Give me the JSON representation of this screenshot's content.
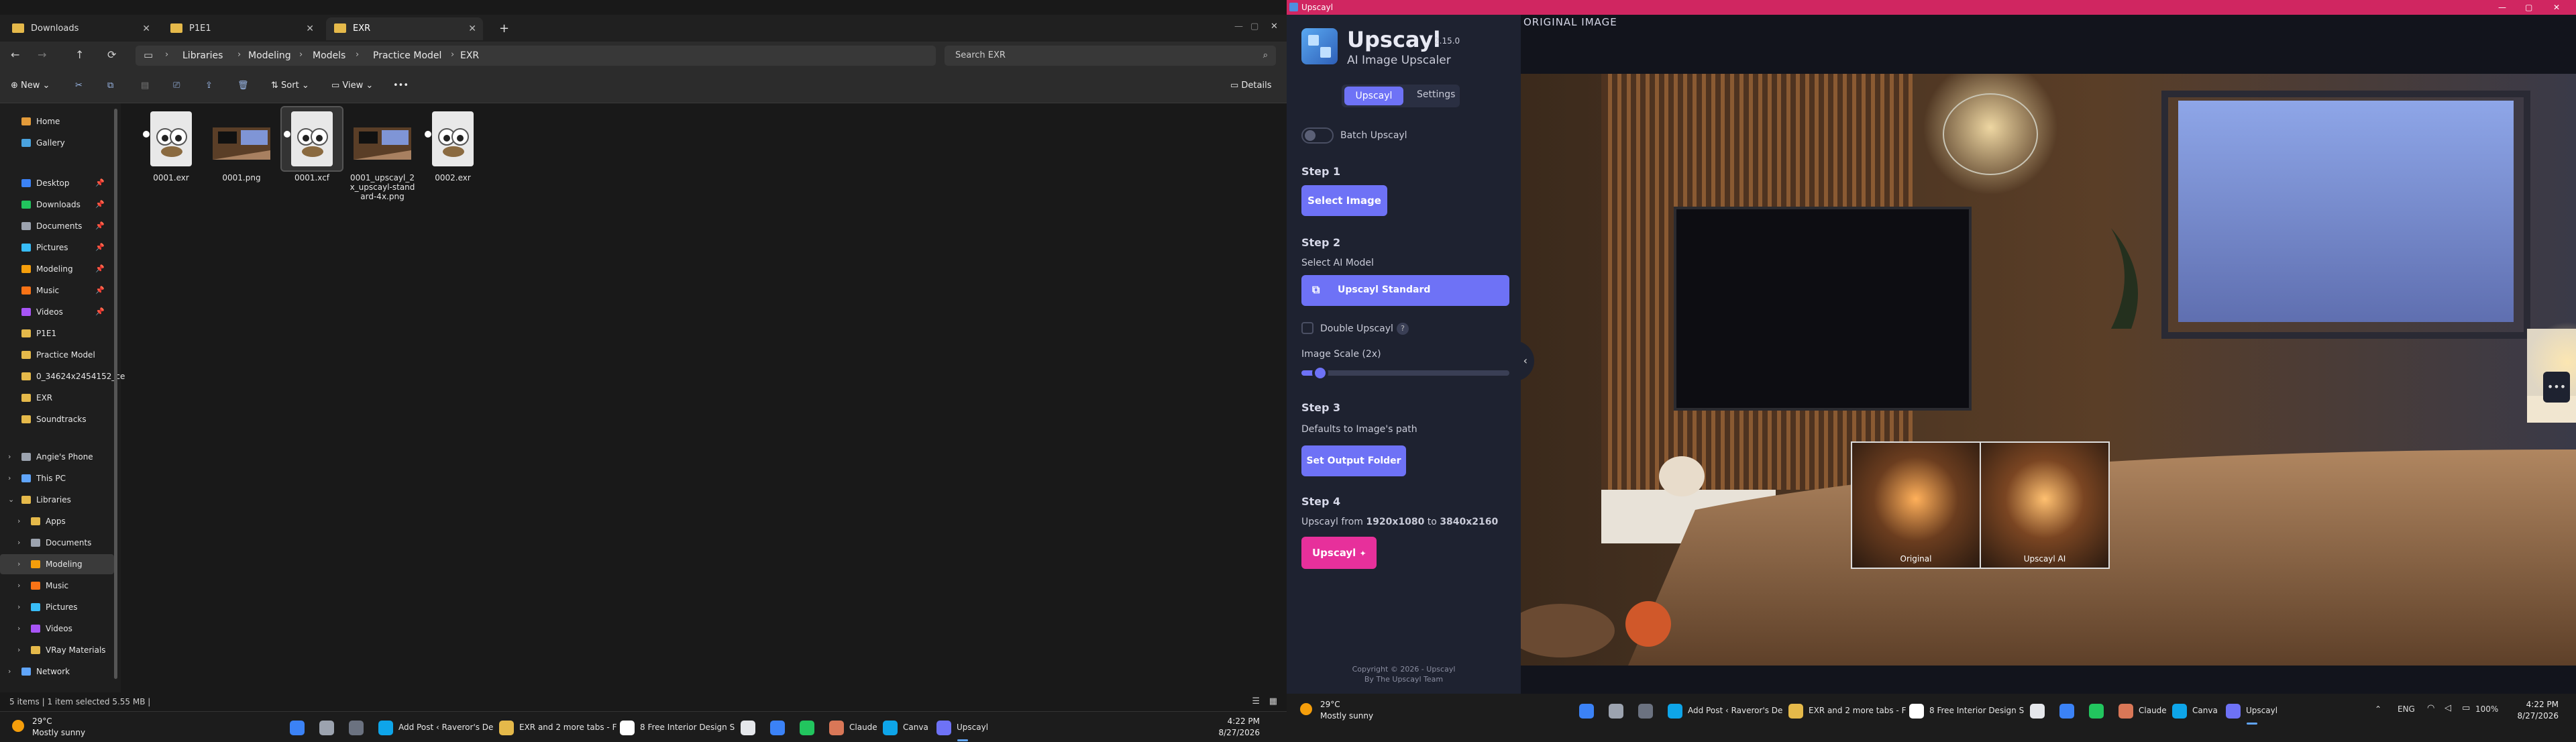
{
  "explorer": {
    "tabs": [
      {
        "label": "Downloads",
        "active": false
      },
      {
        "label": "P1E1",
        "active": false
      },
      {
        "label": "EXR",
        "active": true
      }
    ],
    "window_controls": [
      "—",
      "▢",
      "✕"
    ],
    "breadcrumb": [
      "Libraries",
      "Modeling",
      "Models",
      "Practice Model",
      "EXR"
    ],
    "search_placeholder": "Search EXR",
    "commands": {
      "new": "New",
      "sort": "Sort",
      "view": "View",
      "more": "•••",
      "details": "Details"
    },
    "nav": [
      {
        "label": "Home",
        "color": "#e39b3a",
        "indent": 0,
        "pin": false
      },
      {
        "label": "Gallery",
        "color": "#4aa3df",
        "indent": 0,
        "pin": false
      },
      {
        "label": "Desktop",
        "color": "#3b82f6",
        "indent": 0,
        "pin": true
      },
      {
        "label": "Downloads",
        "color": "#22c55e",
        "indent": 0,
        "pin": true
      },
      {
        "label": "Documents",
        "color": "#9ca3af",
        "indent": 0,
        "pin": true
      },
      {
        "label": "Pictures",
        "color": "#38bdf8",
        "indent": 0,
        "pin": true
      },
      {
        "label": "Modeling",
        "color": "#f59e0b",
        "indent": 0,
        "pin": true
      },
      {
        "label": "Music",
        "color": "#f97316",
        "indent": 0,
        "pin": true
      },
      {
        "label": "Videos",
        "color": "#a855f7",
        "indent": 0,
        "pin": true
      },
      {
        "label": "P1E1",
        "color": "#e5b94a",
        "indent": 0,
        "pin": false
      },
      {
        "label": "Practice Model",
        "color": "#e5b94a",
        "indent": 0,
        "pin": false
      },
      {
        "label": "0_34624x2454152_ce",
        "color": "#e5b94a",
        "indent": 0,
        "pin": false
      },
      {
        "label": "EXR",
        "color": "#e5b94a",
        "indent": 0,
        "pin": false
      },
      {
        "label": "Soundtracks",
        "color": "#e5b94a",
        "indent": 0,
        "pin": false
      },
      {
        "label": "Angie's Phone",
        "color": "#9ca3af",
        "indent": 1,
        "pin": false
      },
      {
        "label": "This PC",
        "color": "#60a5fa",
        "indent": 1,
        "pin": false
      },
      {
        "label": "Libraries",
        "color": "#e5b94a",
        "indent": 1,
        "pin": false
      },
      {
        "label": "Apps",
        "color": "#e5b94a",
        "indent": 2,
        "pin": false
      },
      {
        "label": "Documents",
        "color": "#9ca3af",
        "indent": 2,
        "pin": false
      },
      {
        "label": "Modeling",
        "color": "#f59e0b",
        "indent": 2,
        "pin": false
      },
      {
        "label": "Music",
        "color": "#f97316",
        "indent": 2,
        "pin": false
      },
      {
        "label": "Pictures",
        "color": "#38bdf8",
        "indent": 2,
        "pin": false
      },
      {
        "label": "Videos",
        "color": "#a855f7",
        "indent": 2,
        "pin": false
      },
      {
        "label": "VRay Materials",
        "color": "#e5b94a",
        "indent": 2,
        "pin": false
      },
      {
        "label": "Network",
        "color": "#60a5fa",
        "indent": 1,
        "pin": false
      }
    ],
    "files": [
      {
        "name": "0001.exr",
        "type": "gimp",
        "selected": false
      },
      {
        "name": "0001.png",
        "type": "room",
        "selected": false
      },
      {
        "name": "0001.xcf",
        "type": "gimp",
        "selected": true
      },
      {
        "name": "0001_upscayl_2x_upscayl-standard-4x.png",
        "type": "room",
        "selected": false
      },
      {
        "name": "0002.exr",
        "type": "gimp",
        "selected": false
      }
    ],
    "status": "5 items  |  1 item selected  5.55 MB  |"
  },
  "taskbar_left": {
    "weather_temp": "29°C",
    "weather_desc": "Mostly sunny",
    "items": [
      {
        "label": "",
        "color": "#3b82f6"
      },
      {
        "label": "",
        "color": "#9ca3af"
      },
      {
        "label": "",
        "color": "#6b7280"
      },
      {
        "label": "Add Post ‹ Raveror's De",
        "color": "#0ea5e9"
      },
      {
        "label": "EXR and 2 more tabs - F",
        "color": "#e5b94a"
      },
      {
        "label": "8 Free Interior Design S",
        "color": "#ffffff"
      },
      {
        "label": "",
        "color": "#e5e7eb"
      },
      {
        "label": "",
        "color": "#3b82f6"
      },
      {
        "label": "",
        "color": "#22c55e"
      },
      {
        "label": "Claude",
        "color": "#d97757"
      },
      {
        "label": "Canva",
        "color": "#0ea5e9"
      },
      {
        "label": "Upscayl",
        "color": "#6e72f6"
      }
    ],
    "time": "4:22 PM",
    "date": "8/27/2026"
  },
  "upscayl": {
    "window_title": "Upscayl",
    "app_name": "Upscayl",
    "version": "2.15.0",
    "subtitle": "AI Image Upscaler",
    "tabs": [
      "Upscayl",
      "Settings"
    ],
    "batch_label": "Batch Upscayl",
    "step1": "Step 1",
    "select_image": "Select Image",
    "step2": "Step 2",
    "select_model_label": "Select AI Model",
    "model": "Upscayl Standard",
    "double_label": "Double Upscayl",
    "scale_label": "Image Scale (2x)",
    "scale_fraction": 0.05,
    "step3": "Step 3",
    "defaults_label": "Defaults to Image's path",
    "set_output": "Set Output Folder",
    "step4": "Step 4",
    "upscayl_from_prefix": "Upscayl from",
    "from_res": "1920x1080",
    "to_word": "to",
    "to_res": "3840x2160",
    "upscayl_button": "Upscayl",
    "copyright": "Copyright © 2026 - Upscayl",
    "by": "By The Upscayl Team",
    "preview_label": "ORIGINAL IMAGE",
    "compare_original": "Original",
    "compare_ai": "Upscayl AI",
    "accent": "#6e72f6",
    "pink": "#e7309b"
  },
  "taskbar_right": {
    "weather_temp": "29°C",
    "weather_desc": "Mostly sunny",
    "items": [
      {
        "label": "",
        "color": "#3b82f6"
      },
      {
        "label": "",
        "color": "#9ca3af"
      },
      {
        "label": "",
        "color": "#6b7280"
      },
      {
        "label": "Add Post ‹ Raveror's De",
        "color": "#0ea5e9"
      },
      {
        "label": "EXR and 2 more tabs - F",
        "color": "#e5b94a"
      },
      {
        "label": "8 Free Interior Design S",
        "color": "#ffffff"
      },
      {
        "label": "",
        "color": "#e5e7eb"
      },
      {
        "label": "",
        "color": "#3b82f6"
      },
      {
        "label": "",
        "color": "#22c55e"
      },
      {
        "label": "Claude",
        "color": "#d97757"
      },
      {
        "label": "Canva",
        "color": "#0ea5e9"
      },
      {
        "label": "Upscayl",
        "color": "#6e72f6"
      }
    ],
    "lang": "ENG",
    "battery": "100%",
    "time": "4:22 PM",
    "date": "8/27/2026"
  }
}
